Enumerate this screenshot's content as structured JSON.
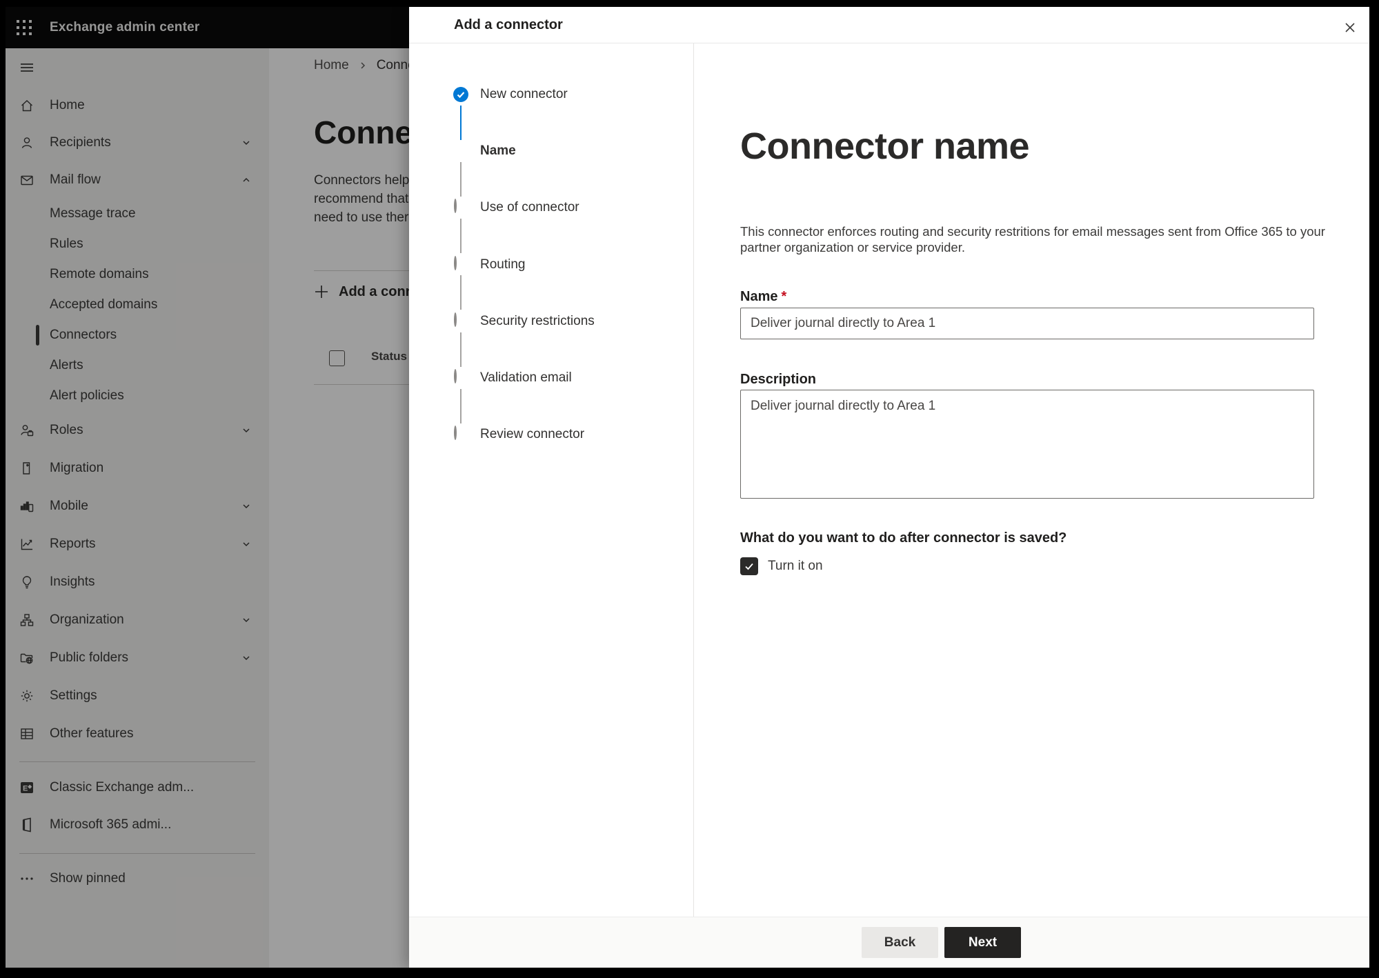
{
  "app": {
    "title": "Exchange admin center"
  },
  "sidebar": {
    "items": [
      {
        "label": "Home"
      },
      {
        "label": "Recipients"
      },
      {
        "label": "Mail flow"
      },
      {
        "label": "Message trace"
      },
      {
        "label": "Rules"
      },
      {
        "label": "Remote domains"
      },
      {
        "label": "Accepted domains"
      },
      {
        "label": "Connectors",
        "selected": true
      },
      {
        "label": "Alerts"
      },
      {
        "label": "Alert policies"
      },
      {
        "label": "Roles"
      },
      {
        "label": "Migration"
      },
      {
        "label": "Mobile"
      },
      {
        "label": "Reports"
      },
      {
        "label": "Insights"
      },
      {
        "label": "Organization"
      },
      {
        "label": "Public folders"
      },
      {
        "label": "Settings"
      },
      {
        "label": "Other features"
      },
      {
        "label": "Classic Exchange adm..."
      },
      {
        "label": "Microsoft 365 admi..."
      },
      {
        "label": "Show pinned"
      }
    ]
  },
  "background": {
    "breadcrumb": {
      "home": "Home",
      "current": "Connectors"
    },
    "heading": "Connectors",
    "description_lines": [
      "Connectors help",
      "recommend that",
      "need to use ther"
    ],
    "add_button": "Add a connector",
    "status_header": "Status"
  },
  "modal": {
    "title": "Add a connector",
    "steps": [
      {
        "label": "New connector",
        "state": "completed"
      },
      {
        "label": "Name",
        "state": "active"
      },
      {
        "label": "Use of connector",
        "state": "todo"
      },
      {
        "label": "Routing",
        "state": "todo"
      },
      {
        "label": "Security restrictions",
        "state": "todo"
      },
      {
        "label": "Validation email",
        "state": "todo"
      },
      {
        "label": "Review connector",
        "state": "todo"
      }
    ],
    "content": {
      "heading": "Connector name",
      "description": "This connector enforces routing and security restritions for email messages sent from Office 365 to your partner organization or service provider.",
      "name_label": "Name",
      "required_marker": "*",
      "name_value": "Deliver journal directly to Area 1",
      "description_label": "Description",
      "description_value": "Deliver journal directly to Area 1",
      "saved_question": "What do you want to do after connector is saved?",
      "turn_on_label": "Turn it on",
      "turn_on_checked": true
    },
    "footer": {
      "back": "Back",
      "next": "Next"
    }
  },
  "colors": {
    "accent": "#0078d4",
    "appbar": "#0a0a0a",
    "next_button": "#242322"
  }
}
